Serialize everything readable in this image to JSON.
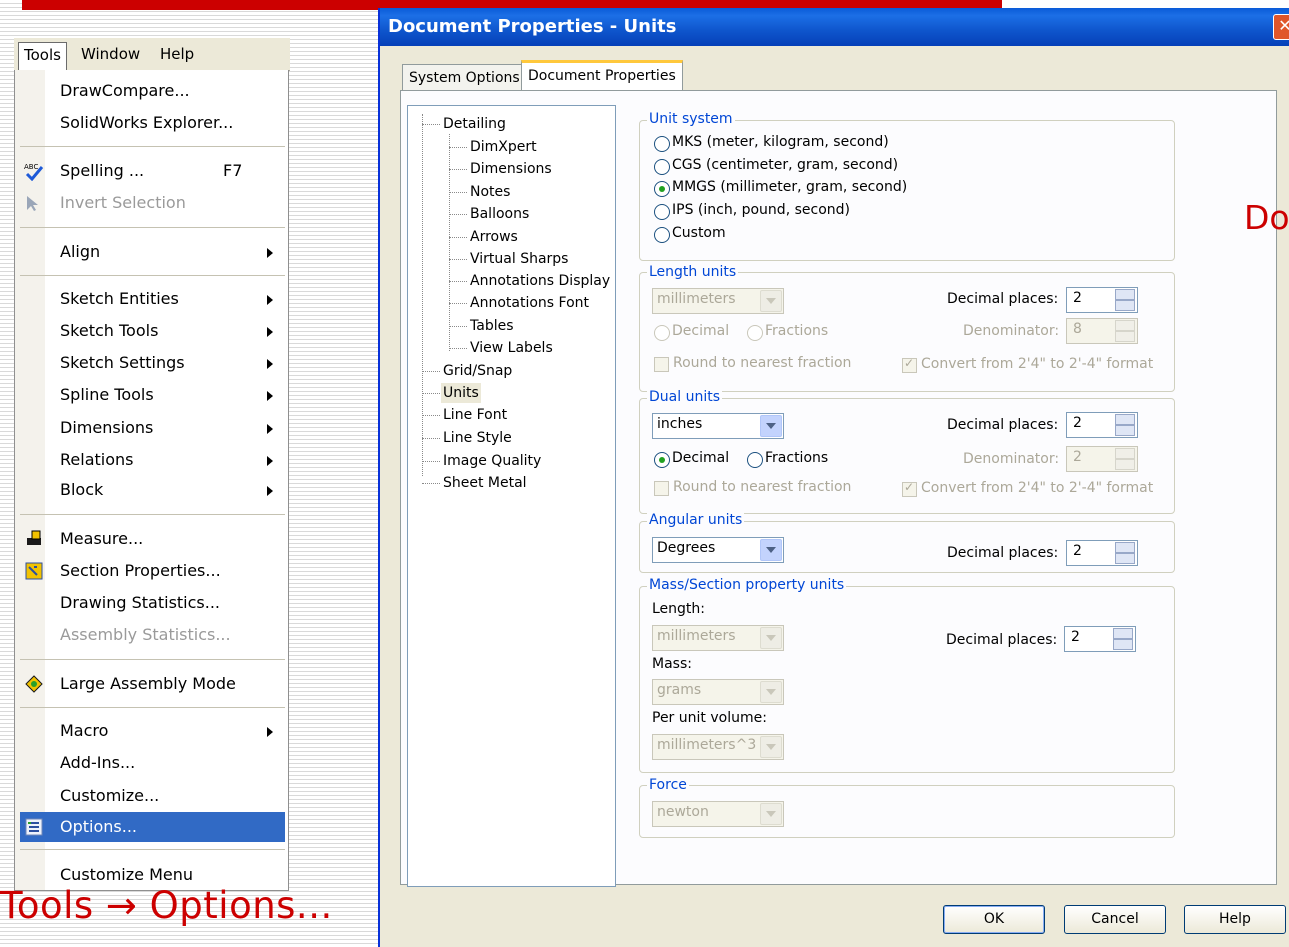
{
  "menu_bar": {
    "items": [
      "Tools",
      "Window",
      "Help"
    ]
  },
  "tools_menu": {
    "items": [
      {
        "label": "DrawCompare..."
      },
      {
        "label": "SolidWorks Explorer..."
      },
      {
        "label": "Spelling ...",
        "shortcut": "F7",
        "icon": "spelling-icon"
      },
      {
        "label": "Invert Selection",
        "disabled": true,
        "icon": "invert-selection-icon"
      },
      {
        "label": "Align",
        "submenu": true
      },
      {
        "label": "Sketch Entities",
        "submenu": true
      },
      {
        "label": "Sketch Tools",
        "submenu": true
      },
      {
        "label": "Sketch Settings",
        "submenu": true
      },
      {
        "label": "Spline Tools",
        "submenu": true
      },
      {
        "label": "Dimensions",
        "submenu": true
      },
      {
        "label": "Relations",
        "submenu": true
      },
      {
        "label": "Block",
        "submenu": true
      },
      {
        "label": "Measure...",
        "icon": "measure-icon"
      },
      {
        "label": "Section Properties...",
        "icon": "section-properties-icon"
      },
      {
        "label": "Drawing Statistics..."
      },
      {
        "label": "Assembly Statistics...",
        "disabled": true
      },
      {
        "label": "Large Assembly Mode",
        "icon": "large-assembly-icon"
      },
      {
        "label": "Macro",
        "submenu": true
      },
      {
        "label": "Add-Ins..."
      },
      {
        "label": "Customize..."
      },
      {
        "label": "Options...",
        "highlighted": true,
        "icon": "options-icon"
      },
      {
        "label": "Customize Menu"
      }
    ]
  },
  "caption": "Tools → Options...",
  "side_caption": "Do",
  "dialog": {
    "title": "Document Properties - Units",
    "close_glyph": "✕",
    "tabs": [
      "System Options",
      "Document Properties"
    ],
    "active_tab": "Document Properties",
    "tree": {
      "detailing": "Detailing",
      "detailing_children": [
        "DimXpert",
        "Dimensions",
        "Notes",
        "Balloons",
        "Arrows",
        "Virtual Sharps",
        "Annotations Display",
        "Annotations Font",
        "Tables",
        "View Labels"
      ],
      "others": [
        "Grid/Snap",
        "Units",
        "Line Font",
        "Line Style",
        "Image Quality",
        "Sheet Metal"
      ],
      "selected": "Units"
    },
    "unit_system": {
      "title": "Unit system",
      "options": [
        "MKS  (meter, kilogram, second)",
        "CGS  (centimeter, gram, second)",
        "MMGS (millimeter, gram, second)",
        "IPS  (inch, pound, second)",
        "Custom"
      ],
      "selected": "MMGS (millimeter, gram, second)"
    },
    "length_units": {
      "title": "Length units",
      "unit": "millimeters",
      "decimal_places_label": "Decimal places:",
      "decimal_places": "2",
      "decimal": "Decimal",
      "fractions": "Fractions",
      "denominator_label": "Denominator:",
      "denominator": "8",
      "round": "Round to nearest fraction",
      "convert": "Convert from 2'4\" to 2'-4\" format"
    },
    "dual_units": {
      "title": "Dual units",
      "unit": "inches",
      "decimal_places_label": "Decimal places:",
      "decimal_places": "2",
      "decimal": "Decimal",
      "fractions": "Fractions",
      "denominator_label": "Denominator:",
      "denominator": "2",
      "round": "Round to nearest fraction",
      "convert": "Convert from 2'4\" to 2'-4\" format"
    },
    "angular_units": {
      "title": "Angular units",
      "unit": "Degrees",
      "decimal_places_label": "Decimal places:",
      "decimal_places": "2"
    },
    "mass_section": {
      "title": "Mass/Section property units",
      "length_label": "Length:",
      "length": "millimeters",
      "decimal_places_label": "Decimal places:",
      "decimal_places": "2",
      "mass_label": "Mass:",
      "mass": "grams",
      "per_unit_volume_label": "Per unit volume:",
      "per_unit_volume": "millimeters^3"
    },
    "force": {
      "title": "Force",
      "unit": "newton"
    },
    "buttons": {
      "ok": "OK",
      "cancel": "Cancel",
      "help": "Help"
    }
  }
}
